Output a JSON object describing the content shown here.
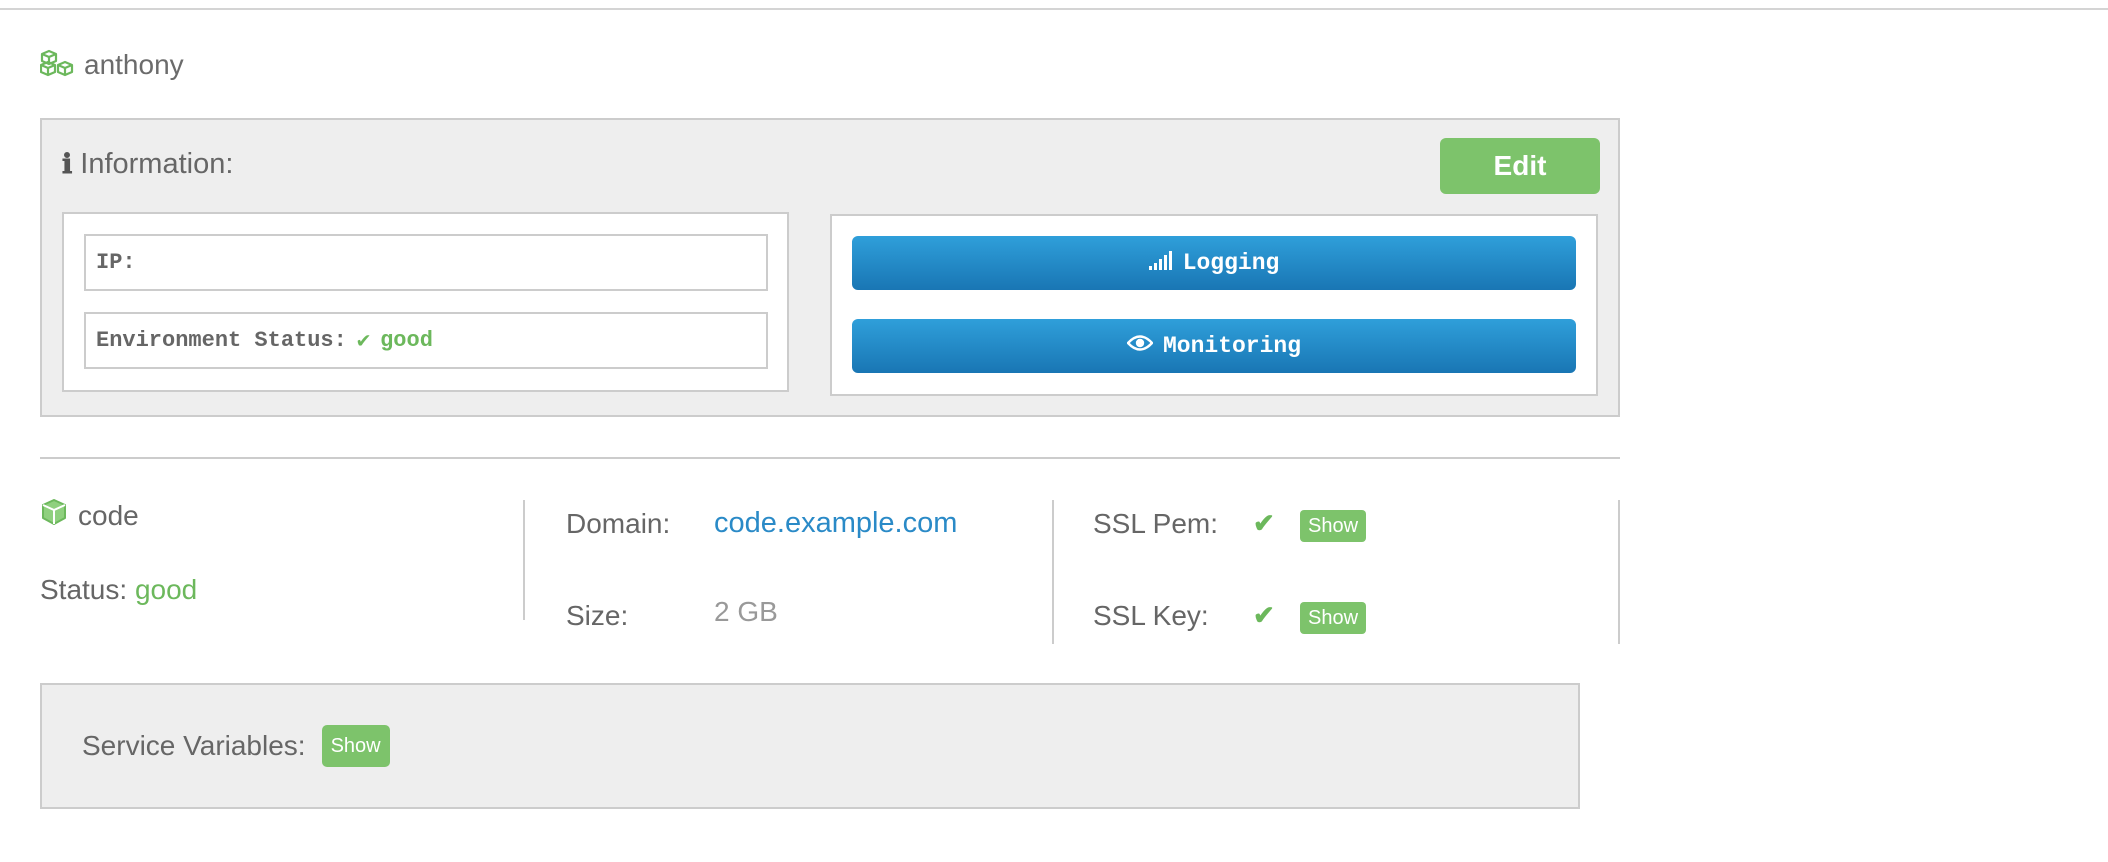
{
  "environment": {
    "name": "anthony",
    "icon": "cubes-icon"
  },
  "info": {
    "title": "Information:",
    "edit_label": "Edit",
    "ip_label": "IP:",
    "ip_value": "",
    "env_status_label": "Environment Status:",
    "env_status_value": "good",
    "logging_label": "Logging",
    "monitoring_label": "Monitoring"
  },
  "service": {
    "name": "code",
    "status_label": "Status:",
    "status_value": "good",
    "domain_label": "Domain:",
    "domain_value": "code.example.com",
    "size_label": "Size:",
    "size_value": "2 GB",
    "ssl_pem_label": "SSL Pem:",
    "ssl_key_label": "SSL Key:",
    "show_label": "Show"
  },
  "variables": {
    "label": "Service Variables:",
    "show_label": "Show"
  },
  "colors": {
    "accent_green": "#7dc36b",
    "status_good": "#6cb85c",
    "button_blue": "#1e88c8",
    "link_blue": "#2a8ac7",
    "panel_bg": "#eeeeee"
  }
}
